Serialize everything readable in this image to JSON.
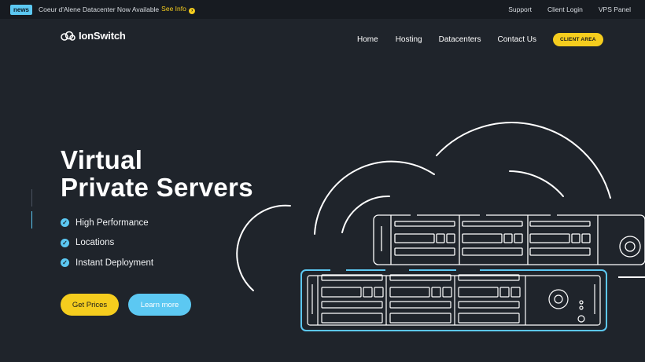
{
  "announcement": {
    "badge": "news",
    "text": "Coeur d'Alene Datacenter Now Available",
    "link_text": "See Info",
    "arrow_icon": "arrow-right-circle-icon"
  },
  "top_links": [
    "Support",
    "Client Login",
    "VPS Panel"
  ],
  "brand": {
    "name": "IonSwitch",
    "logo_icon": "cloud-rings-icon"
  },
  "nav": {
    "items": [
      "Home",
      "Hosting",
      "Datacenters",
      "Contact Us"
    ],
    "cta": "CLIENT AREA"
  },
  "hero": {
    "title_line1": "Virtual",
    "title_line2": "Private Servers",
    "features": [
      "High Performance",
      "Locations",
      "Instant Deployment"
    ],
    "primary_button": "Get Prices",
    "secondary_button": "Learn more"
  },
  "colors": {
    "background": "#1f242b",
    "accent_yellow": "#f5cd1e",
    "accent_blue": "#5cc8f2"
  }
}
